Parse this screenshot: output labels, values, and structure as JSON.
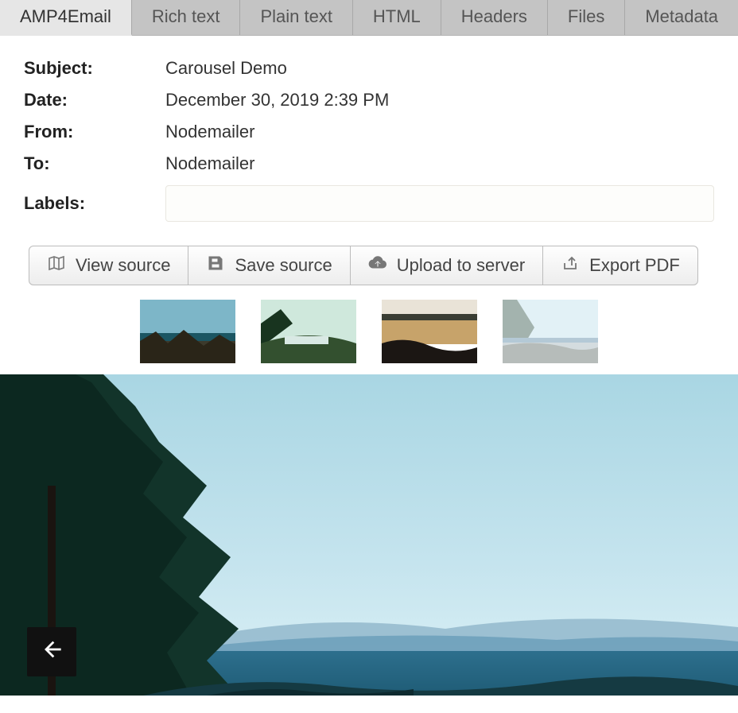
{
  "tabs": [
    {
      "label": "AMP4Email",
      "active": true
    },
    {
      "label": "Rich text",
      "active": false
    },
    {
      "label": "Plain text",
      "active": false
    },
    {
      "label": "HTML",
      "active": false
    },
    {
      "label": "Headers",
      "active": false
    },
    {
      "label": "Files",
      "active": false
    },
    {
      "label": "Metadata",
      "active": false
    }
  ],
  "meta": {
    "subject_label": "Subject:",
    "subject_value": "Carousel Demo",
    "date_label": "Date:",
    "date_value": "December 30, 2019 2:39 PM",
    "from_label": "From:",
    "from_value": "Nodemailer",
    "to_label": "To:",
    "to_value": "Nodemailer",
    "labels_label": "Labels:",
    "labels_value": ""
  },
  "actions": {
    "view_source": "View source",
    "save_source": "Save source",
    "upload": "Upload to server",
    "export_pdf": "Export PDF"
  },
  "carousel": {
    "thumbnails": [
      {
        "name": "thumb-1",
        "selected": false
      },
      {
        "name": "thumb-2",
        "selected": false
      },
      {
        "name": "thumb-3",
        "selected": false
      },
      {
        "name": "thumb-4",
        "selected": true
      }
    ],
    "prev_aria": "Previous image"
  }
}
